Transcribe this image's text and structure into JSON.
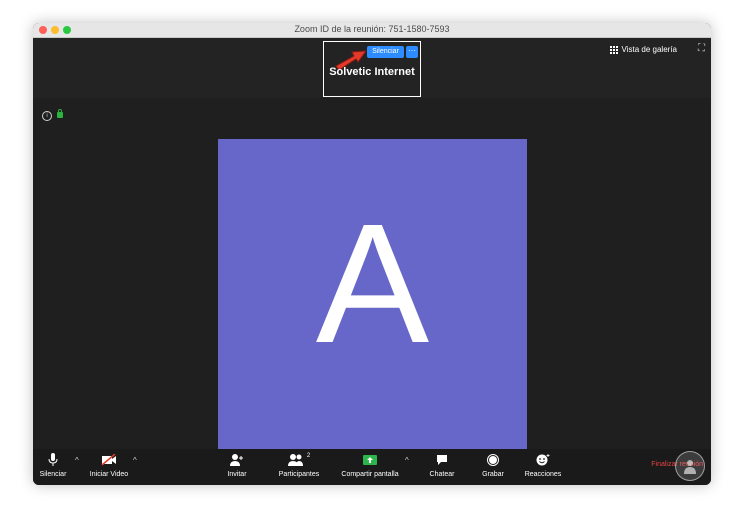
{
  "window": {
    "title": "Zoom ID de la reunión: 751-1580-7593"
  },
  "speaker": {
    "mute_label": "Silenciar",
    "more_label": "···",
    "name": "Solvetic Internet"
  },
  "view": {
    "gallery_label": "Vista de galería"
  },
  "participant": {
    "initial": "A",
    "avatar_color": "#6667c9"
  },
  "toolbar": {
    "mute_label": "Silenciar",
    "video_label": "Iniciar Video",
    "invite_label": "Invitar",
    "participants_label": "Participantes",
    "participants_count": "2",
    "share_label": "Compartir pantalla",
    "chat_label": "Chatear",
    "record_label": "Grabar",
    "reactions_label": "Reacciones",
    "end_label": "Finalizar reunión"
  },
  "colors": {
    "accent": "#2d8cff",
    "share_green": "#2bb54a",
    "end_red": "#e54343"
  }
}
